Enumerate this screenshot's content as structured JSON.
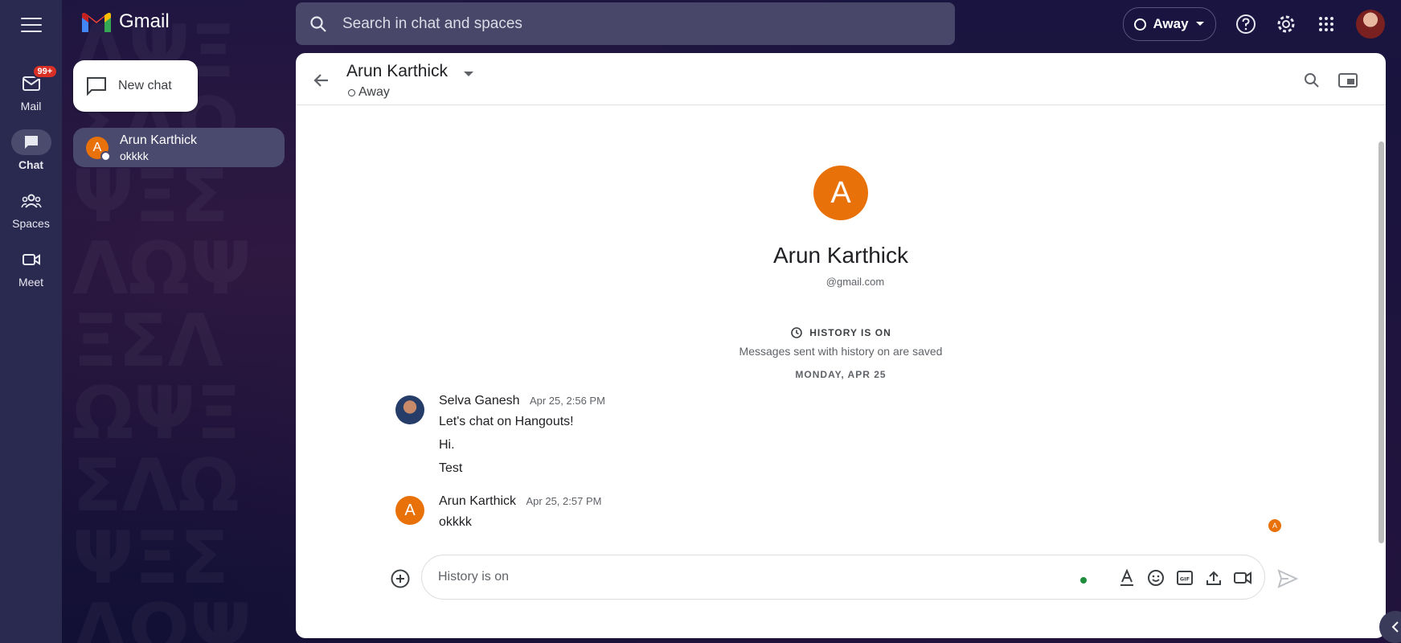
{
  "app": {
    "name": "Gmail"
  },
  "rail": {
    "items": [
      {
        "label": "Mail",
        "badge": "99+",
        "icon": "mail-icon"
      },
      {
        "label": "Chat",
        "icon": "chat-icon",
        "active": true
      },
      {
        "label": "Spaces",
        "icon": "spaces-icon"
      },
      {
        "label": "Meet",
        "icon": "meet-icon"
      }
    ]
  },
  "search": {
    "placeholder": "Search in chat and spaces"
  },
  "status": {
    "label": "Away"
  },
  "sidebar": {
    "new_chat_label": "New chat",
    "chats": [
      {
        "initial": "A",
        "name": "Arun Karthick",
        "preview": "okkkk"
      }
    ]
  },
  "conversation": {
    "header_name": "Arun Karthick",
    "header_status": "Away",
    "profile": {
      "initial": "A",
      "name": "Arun Karthick",
      "email": "@gmail.com"
    },
    "history_title": "HISTORY IS ON",
    "history_sub": "Messages sent with history on are saved",
    "date_divider": "MONDAY, APR 25",
    "messages": [
      {
        "sender": "Selva Ganesh",
        "time": "Apr 25, 2:56 PM",
        "lines": [
          "Let's chat on Hangouts!",
          "Hi.",
          "Test"
        ]
      },
      {
        "sender": "Arun Karthick",
        "initial": "A",
        "time": "Apr 25, 2:57 PM",
        "lines": [
          "okkkk"
        ]
      }
    ],
    "read_receipt_initial": "A",
    "composer_placeholder": "History is on"
  },
  "colors": {
    "accent_orange": "#e8710a",
    "panel_bg": "#ffffff",
    "app_bg": "#15123a"
  }
}
